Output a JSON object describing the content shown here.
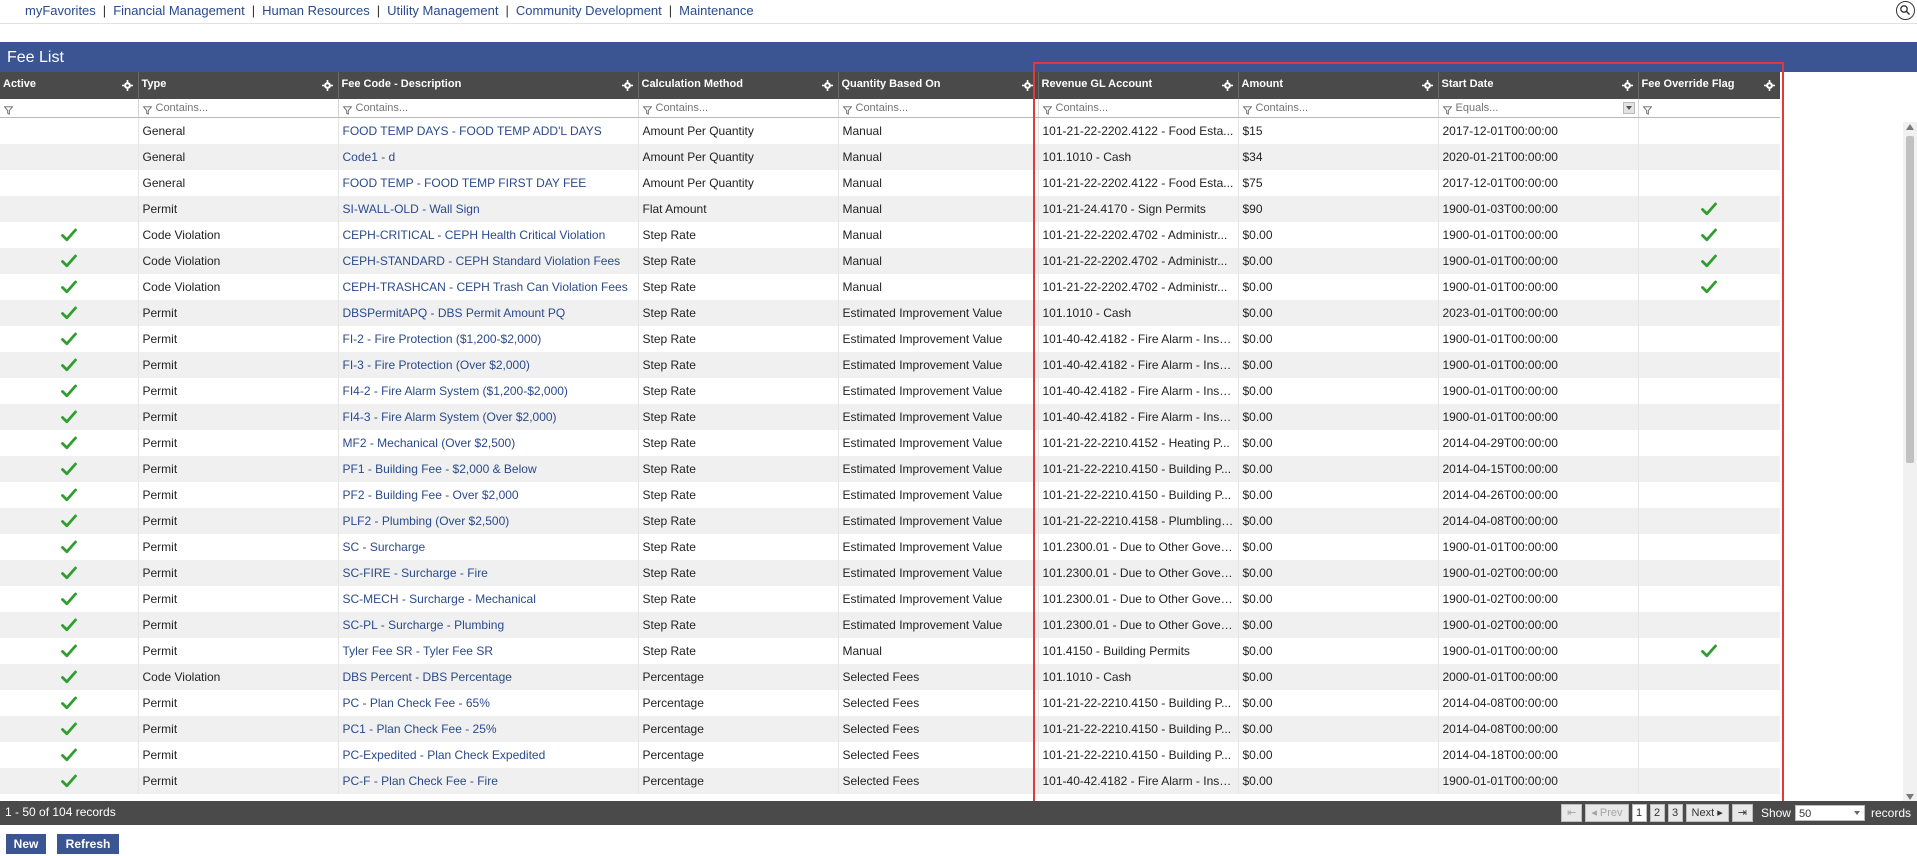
{
  "nav": {
    "links": [
      "myFavorites",
      "Financial Management",
      "Human Resources",
      "Utility Management",
      "Community Development",
      "Maintenance"
    ],
    "search_icon": "search-icon"
  },
  "page": {
    "title": "Fee List"
  },
  "grid": {
    "columns": [
      {
        "label": "Active",
        "filter": "",
        "filter_placeholder": ""
      },
      {
        "label": "Type",
        "filter": "",
        "filter_placeholder": "Contains..."
      },
      {
        "label": "Fee Code - Description",
        "filter": "",
        "filter_placeholder": "Contains..."
      },
      {
        "label": "Calculation Method",
        "filter": "",
        "filter_placeholder": "Contains..."
      },
      {
        "label": "Quantity Based On",
        "filter": "",
        "filter_placeholder": "Contains..."
      },
      {
        "label": "Revenue GL Account",
        "filter": "",
        "filter_placeholder": "Contains..."
      },
      {
        "label": "Amount",
        "filter": "",
        "filter_placeholder": "Contains..."
      },
      {
        "label": "Start Date",
        "filter": "",
        "filter_placeholder": "Equals..."
      },
      {
        "label": "Fee Override Flag",
        "filter": "",
        "filter_placeholder": ""
      }
    ],
    "rows": [
      {
        "active": false,
        "type": "General",
        "fee": "FOOD TEMP DAYS - FOOD TEMP ADD'L DAYS",
        "calc": "Amount Per Quantity",
        "qty": "Manual",
        "gl": "101-21-22-2202.4122 - Food Esta...",
        "amount": "$15",
        "start": "2017-12-01T00:00:00",
        "override": false
      },
      {
        "active": false,
        "type": "General",
        "fee": "Code1 - d",
        "calc": "Amount Per Quantity",
        "qty": "Manual",
        "gl": "101.1010 - Cash",
        "amount": "$34",
        "start": "2020-01-21T00:00:00",
        "override": false
      },
      {
        "active": false,
        "type": "General",
        "fee": "FOOD TEMP - FOOD TEMP FIRST DAY FEE",
        "calc": "Amount Per Quantity",
        "qty": "Manual",
        "gl": "101-21-22-2202.4122 - Food Esta...",
        "amount": "$75",
        "start": "2017-12-01T00:00:00",
        "override": false
      },
      {
        "active": false,
        "type": "Permit",
        "fee": "SI-WALL-OLD - Wall Sign",
        "calc": "Flat Amount",
        "qty": "Manual",
        "gl": "101-21-24.4170 - Sign Permits",
        "amount": "$90",
        "start": "1900-01-03T00:00:00",
        "override": true
      },
      {
        "active": true,
        "type": "Code Violation",
        "fee": "CEPH-CRITICAL - CEPH Health Critical Violation",
        "calc": "Step Rate",
        "qty": "Manual",
        "gl": "101-21-22-2202.4702 - Administr...",
        "amount": "$0.00",
        "start": "1900-01-01T00:00:00",
        "override": true
      },
      {
        "active": true,
        "type": "Code Violation",
        "fee": "CEPH-STANDARD - CEPH Standard Violation Fees",
        "calc": "Step Rate",
        "qty": "Manual",
        "gl": "101-21-22-2202.4702 - Administr...",
        "amount": "$0.00",
        "start": "1900-01-01T00:00:00",
        "override": true
      },
      {
        "active": true,
        "type": "Code Violation",
        "fee": "CEPH-TRASHCAN - CEPH Trash Can Violation Fees",
        "calc": "Step Rate",
        "qty": "Manual",
        "gl": "101-21-22-2202.4702 - Administr...",
        "amount": "$0.00",
        "start": "1900-01-01T00:00:00",
        "override": true
      },
      {
        "active": true,
        "type": "Permit",
        "fee": "DBSPermitAPQ - DBS Permit Amount PQ",
        "calc": "Step Rate",
        "qty": "Estimated Improvement Value",
        "gl": "101.1010 - Cash",
        "amount": "$0.00",
        "start": "2023-01-01T00:00:00",
        "override": false
      },
      {
        "active": true,
        "type": "Permit",
        "fee": "FI-2 - Fire Protection ($1,200-$2,000)",
        "calc": "Step Rate",
        "qty": "Estimated Improvement Value",
        "gl": "101-40-42.4182 - Fire Alarm - Insp...",
        "amount": "$0.00",
        "start": "1900-01-01T00:00:00",
        "override": false
      },
      {
        "active": true,
        "type": "Permit",
        "fee": "FI-3 - Fire Protection (Over $2,000)",
        "calc": "Step Rate",
        "qty": "Estimated Improvement Value",
        "gl": "101-40-42.4182 - Fire Alarm - Insp...",
        "amount": "$0.00",
        "start": "1900-01-01T00:00:00",
        "override": false
      },
      {
        "active": true,
        "type": "Permit",
        "fee": "FI4-2 - Fire Alarm System ($1,200-$2,000)",
        "calc": "Step Rate",
        "qty": "Estimated Improvement Value",
        "gl": "101-40-42.4182 - Fire Alarm - Insp...",
        "amount": "$0.00",
        "start": "1900-01-01T00:00:00",
        "override": false
      },
      {
        "active": true,
        "type": "Permit",
        "fee": "FI4-3 - Fire Alarm System (Over $2,000)",
        "calc": "Step Rate",
        "qty": "Estimated Improvement Value",
        "gl": "101-40-42.4182 - Fire Alarm - Insp...",
        "amount": "$0.00",
        "start": "1900-01-01T00:00:00",
        "override": false
      },
      {
        "active": true,
        "type": "Permit",
        "fee": "MF2 - Mechanical (Over $2,500)",
        "calc": "Step Rate",
        "qty": "Estimated Improvement Value",
        "gl": "101-21-22-2210.4152 - Heating P...",
        "amount": "$0.00",
        "start": "2014-04-29T00:00:00",
        "override": false
      },
      {
        "active": true,
        "type": "Permit",
        "fee": "PF1 - Building Fee - $2,000 & Below",
        "calc": "Step Rate",
        "qty": "Estimated Improvement Value",
        "gl": "101-21-22-2210.4150 - Building P...",
        "amount": "$0.00",
        "start": "2014-04-15T00:00:00",
        "override": false
      },
      {
        "active": true,
        "type": "Permit",
        "fee": "PF2 - Building Fee - Over $2,000",
        "calc": "Step Rate",
        "qty": "Estimated Improvement Value",
        "gl": "101-21-22-2210.4150 - Building P...",
        "amount": "$0.00",
        "start": "2014-04-26T00:00:00",
        "override": false
      },
      {
        "active": true,
        "type": "Permit",
        "fee": "PLF2 - Plumbing (Over $2,500)",
        "calc": "Step Rate",
        "qty": "Estimated Improvement Value",
        "gl": "101-21-22-2210.4158 - Plumbling ...",
        "amount": "$0.00",
        "start": "2014-04-08T00:00:00",
        "override": false
      },
      {
        "active": true,
        "type": "Permit",
        "fee": "SC - Surcharge",
        "calc": "Step Rate",
        "qty": "Estimated Improvement Value",
        "gl": "101.2300.01 - Due to Other Gover...",
        "amount": "$0.00",
        "start": "1900-01-01T00:00:00",
        "override": false
      },
      {
        "active": true,
        "type": "Permit",
        "fee": "SC-FIRE - Surcharge - Fire",
        "calc": "Step Rate",
        "qty": "Estimated Improvement Value",
        "gl": "101.2300.01 - Due to Other Gover...",
        "amount": "$0.00",
        "start": "1900-01-02T00:00:00",
        "override": false
      },
      {
        "active": true,
        "type": "Permit",
        "fee": "SC-MECH - Surcharge - Mechanical",
        "calc": "Step Rate",
        "qty": "Estimated Improvement Value",
        "gl": "101.2300.01 - Due to Other Gover...",
        "amount": "$0.00",
        "start": "1900-01-02T00:00:00",
        "override": false
      },
      {
        "active": true,
        "type": "Permit",
        "fee": "SC-PL - Surcharge - Plumbing",
        "calc": "Step Rate",
        "qty": "Estimated Improvement Value",
        "gl": "101.2300.01 - Due to Other Gover...",
        "amount": "$0.00",
        "start": "1900-01-02T00:00:00",
        "override": false
      },
      {
        "active": true,
        "type": "Permit",
        "fee": "Tyler Fee SR - Tyler Fee SR",
        "calc": "Step Rate",
        "qty": "Manual",
        "gl": "101.4150 - Building Permits",
        "amount": "$0.00",
        "start": "1900-01-01T00:00:00",
        "override": true
      },
      {
        "active": true,
        "type": "Code Violation",
        "fee": "DBS Percent - DBS Percentage",
        "calc": "Percentage",
        "qty": "Selected Fees",
        "gl": "101.1010 - Cash",
        "amount": "$0.00",
        "start": "2000-01-01T00:00:00",
        "override": false
      },
      {
        "active": true,
        "type": "Permit",
        "fee": "PC - Plan Check Fee - 65%",
        "calc": "Percentage",
        "qty": "Selected Fees",
        "gl": "101-21-22-2210.4150 - Building P...",
        "amount": "$0.00",
        "start": "2014-04-08T00:00:00",
        "override": false
      },
      {
        "active": true,
        "type": "Permit",
        "fee": "PC1 - Plan Check Fee - 25%",
        "calc": "Percentage",
        "qty": "Selected Fees",
        "gl": "101-21-22-2210.4150 - Building P...",
        "amount": "$0.00",
        "start": "2014-04-08T00:00:00",
        "override": false
      },
      {
        "active": true,
        "type": "Permit",
        "fee": "PC-Expedited - Plan Check Expedited",
        "calc": "Percentage",
        "qty": "Selected Fees",
        "gl": "101-21-22-2210.4150 - Building P...",
        "amount": "$0.00",
        "start": "2014-04-18T00:00:00",
        "override": false
      },
      {
        "active": true,
        "type": "Permit",
        "fee": "PC-F - Plan Check Fee - Fire",
        "calc": "Percentage",
        "qty": "Selected Fees",
        "gl": "101-40-42.4182 - Fire Alarm - Insp...",
        "amount": "$0.00",
        "start": "1900-01-01T00:00:00",
        "override": false
      }
    ]
  },
  "footer": {
    "record_count": "1 - 50 of 104 records",
    "pager": {
      "first_label": "⇤",
      "prev_label": "◂ Prev",
      "pages": [
        "1",
        "2",
        "3"
      ],
      "current_page": "1",
      "next_label": "Next ▸",
      "last_label": "⇥",
      "show_label": "Show",
      "page_size": "50",
      "records_label": "records"
    }
  },
  "buttons": {
    "new": "New",
    "refresh": "Refresh"
  },
  "colors": {
    "accent": "#3b5492",
    "header": "#4a4a4a",
    "link": "#2a4a8b",
    "check": "#2e9e2e",
    "highlight": "#e03a3a"
  }
}
